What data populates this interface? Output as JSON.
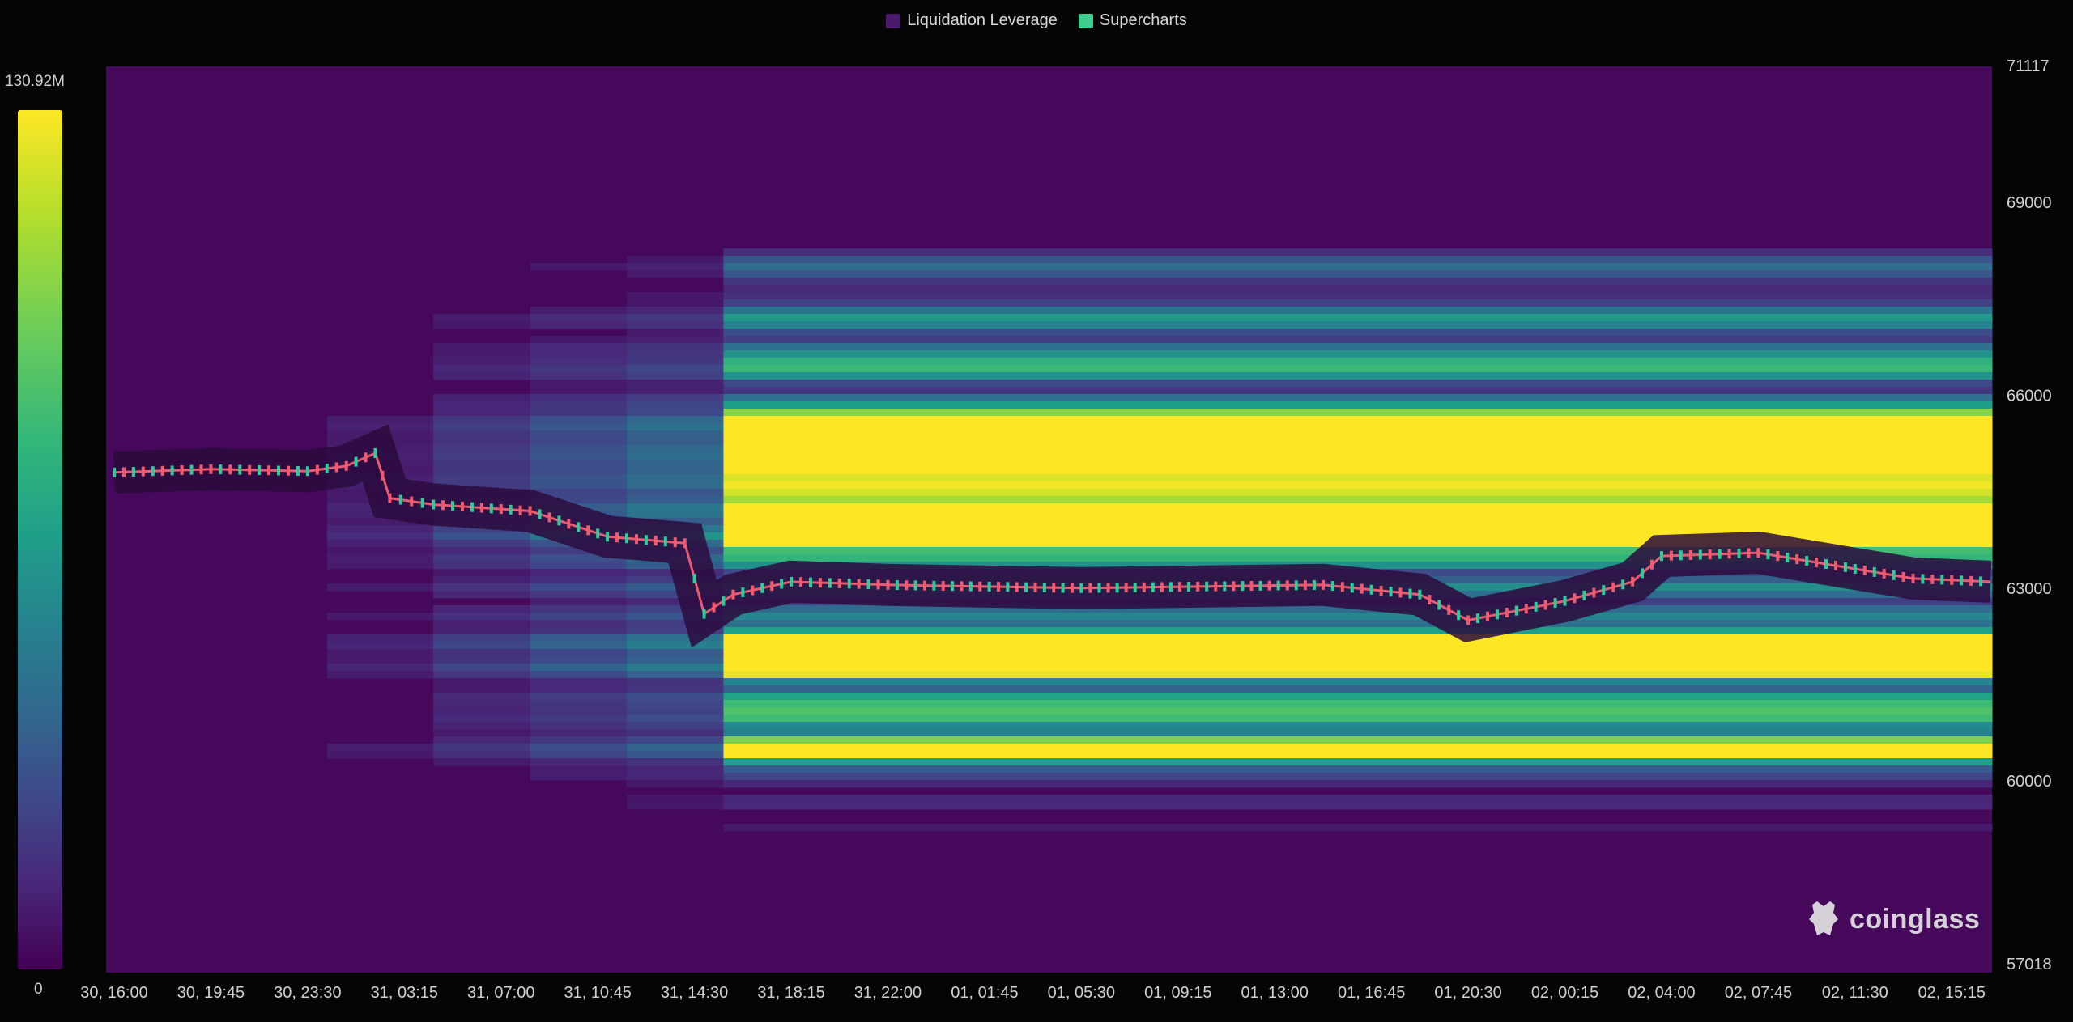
{
  "legend": [
    {
      "label": "Liquidation Leverage",
      "color": "#4a1a6b"
    },
    {
      "label": "Supercharts",
      "color": "#3ecf8e"
    }
  ],
  "colorbar": {
    "max_label": "130.92M",
    "min_label": "0"
  },
  "watermark": "coinglass",
  "chart_data": {
    "type": "heatmap",
    "title": "",
    "x_tick_labels": [
      "30, 16:00",
      "30, 19:45",
      "30, 23:30",
      "31, 03:15",
      "31, 07:00",
      "31, 10:45",
      "31, 14:30",
      "31, 18:15",
      "31, 22:00",
      "01, 01:45",
      "01, 05:30",
      "01, 09:15",
      "01, 13:00",
      "01, 16:45",
      "01, 20:30",
      "02, 00:15",
      "02, 04:00",
      "02, 07:45",
      "02, 11:30",
      "02, 15:15"
    ],
    "y_tick_labels": [
      "71117",
      "69000",
      "66000",
      "63000",
      "60000",
      "57018"
    ],
    "ylim": [
      57018,
      71117
    ],
    "colorscale": "viridis",
    "value_range": [
      0,
      130.92
    ],
    "value_unit": "M",
    "price_series": [
      [
        0,
        64800
      ],
      [
        1,
        64850
      ],
      [
        2,
        64820
      ],
      [
        2.4,
        64900
      ],
      [
        2.7,
        65100
      ],
      [
        2.85,
        64400
      ],
      [
        3.3,
        64300
      ],
      [
        4.3,
        64200
      ],
      [
        5.1,
        63800
      ],
      [
        5.9,
        63700
      ],
      [
        6.1,
        62600
      ],
      [
        6.4,
        62900
      ],
      [
        7.0,
        63100
      ],
      [
        8,
        63050
      ],
      [
        10,
        63000
      ],
      [
        12.5,
        63050
      ],
      [
        13.5,
        62900
      ],
      [
        14.0,
        62500
      ],
      [
        15.0,
        62800
      ],
      [
        15.7,
        63100
      ],
      [
        16.0,
        63500
      ],
      [
        17.0,
        63550
      ],
      [
        18.0,
        63300
      ],
      [
        18.6,
        63150
      ],
      [
        19.4,
        63100
      ]
    ],
    "bands": [
      {
        "y": 65600,
        "x_start": 6.3,
        "intensity": 0.95
      },
      {
        "y": 65300,
        "x_start": 6.3,
        "intensity": 1.0
      },
      {
        "y": 64900,
        "x_start": 6.3,
        "intensity": 1.0
      },
      {
        "y": 64500,
        "x_start": 6.3,
        "intensity": 0.75
      },
      {
        "y": 64100,
        "x_start": 6.3,
        "intensity": 0.9
      },
      {
        "y": 63800,
        "x_start": 6.3,
        "intensity": 1.0
      },
      {
        "y": 62100,
        "x_start": 6.3,
        "intensity": 1.0
      },
      {
        "y": 61800,
        "x_start": 6.3,
        "intensity": 1.0
      },
      {
        "y": 60500,
        "x_start": 6.3,
        "intensity": 0.95
      },
      {
        "y": 61100,
        "x_start": 6.3,
        "intensity": 0.6
      },
      {
        "y": 66500,
        "x_start": 6.3,
        "intensity": 0.55
      },
      {
        "y": 67200,
        "x_start": 6.3,
        "intensity": 0.4
      },
      {
        "y": 68000,
        "x_start": 6.3,
        "intensity": 0.3
      }
    ]
  }
}
